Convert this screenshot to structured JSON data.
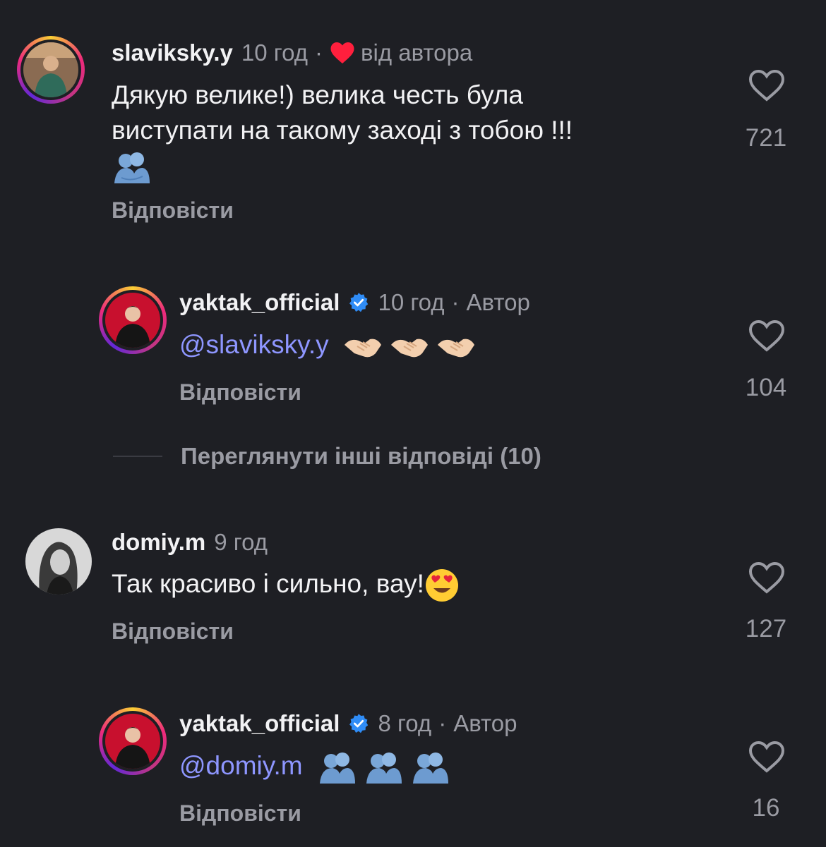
{
  "comments": [
    {
      "username": "slaviksky.y",
      "time": "10 год",
      "author_liked_label": "від автора",
      "text_line1": "Дякую велике!) велика честь була",
      "text_line2": "виступати на такому заході з тобою !!!",
      "reply_label": "Відповісти",
      "likes": "721"
    },
    {
      "username": "yaktak_official",
      "time": "10 год",
      "role": "Автор",
      "mention": "@slaviksky.y",
      "reply_label": "Відповісти",
      "likes": "104"
    },
    {
      "username": "domiy.m",
      "time": "9 год",
      "text": "Так красиво і сильно, вау!",
      "reply_label": "Відповісти",
      "likes": "127"
    },
    {
      "username": "yaktak_official",
      "time": "8 год",
      "role": "Автор",
      "mention": "@domiy.m",
      "reply_label": "Відповісти",
      "likes": "16"
    }
  ],
  "view_more_replies": "Переглянути інші відповіді (10)",
  "separator": "·",
  "colors": {
    "background": "#1e1f24",
    "mention": "#8e96ff",
    "verified": "#2f8cf6",
    "author_heart": "#ff1f3d",
    "muted": "#9a9ba3"
  },
  "icons": [
    "heart-outline-icon",
    "heart-filled-icon",
    "verified-badge-icon",
    "people-hugging-emoji",
    "handshake-emoji",
    "heart-eyes-emoji"
  ]
}
